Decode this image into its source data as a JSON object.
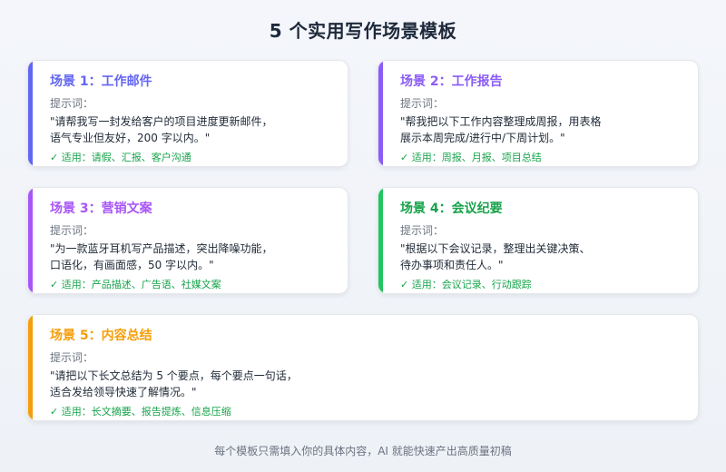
{
  "title": "5 个实用写作场景模板",
  "cards": [
    {
      "title": "场景 1：工作邮件",
      "prompt_label": "提示词：",
      "prompt_line1": "\"请帮我写一封发给客户的项目进度更新邮件，",
      "prompt_line2": "语气专业但友好，200 字以内。\"",
      "usage": "✓ 适用：请假、汇报、客户沟通",
      "accent": "#6366f1"
    },
    {
      "title": "场景 2：工作报告",
      "prompt_label": "提示词：",
      "prompt_line1": "\"帮我把以下工作内容整理成周报，用表格",
      "prompt_line2": "展示本周完成/进行中/下周计划。\"",
      "usage": "✓ 适用：周报、月报、项目总结",
      "accent": "#8b5cf6"
    },
    {
      "title": "场景 3：营销文案",
      "prompt_label": "提示词：",
      "prompt_line1": "\"为一款蓝牙耳机写产品描述，突出降噪功能，",
      "prompt_line2": "口语化，有画面感，50 字以内。\"",
      "usage": "✓ 适用：产品描述、广告语、社媒文案",
      "accent": "#a855f7"
    },
    {
      "title": "场景 4：会议纪要",
      "prompt_label": "提示词：",
      "prompt_line1": "\"根据以下会议记录，整理出关键决策、",
      "prompt_line2": "待办事项和责任人。\"",
      "usage": "✓ 适用：会议记录、行动跟踪",
      "accent": "#22c55e"
    },
    {
      "title": "场景 5：内容总结",
      "prompt_label": "提示词：",
      "prompt_line1": "\"请把以下长文总结为 5 个要点，每个要点一句话，",
      "prompt_line2": "适合发给领导快速了解情况。\"",
      "usage": "✓ 适用：长文摘要、报告提炼、信息压缩",
      "accent": "#f59e0b"
    }
  ],
  "footer": "每个模板只需填入你的具体内容，AI 就能快速产出高质量初稿"
}
